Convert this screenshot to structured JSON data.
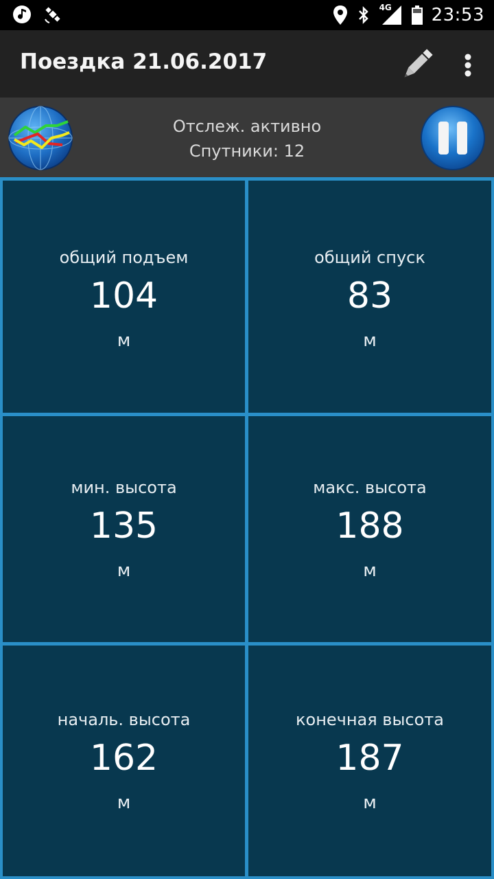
{
  "status_bar": {
    "time": "23:53",
    "network": "4G",
    "icons": [
      "music-note-icon",
      "satellite-icon",
      "location-pin-icon",
      "bluetooth-icon",
      "signal-icon",
      "battery-icon"
    ]
  },
  "app_bar": {
    "title": "Поездка 21.06.2017",
    "actions": [
      "pencil-icon",
      "overflow-menu-icon"
    ]
  },
  "tracking": {
    "status": "Отслеж. активно",
    "satellites": "Спутники: 12",
    "left_icon": "track-globe-icon",
    "right_icon": "pause-icon"
  },
  "stats": [
    {
      "label": "общий подъем",
      "value": "104",
      "unit": "м"
    },
    {
      "label": "общий спуск",
      "value": "83",
      "unit": "м"
    },
    {
      "label": "мин. высота",
      "value": "135",
      "unit": "м"
    },
    {
      "label": "макс. высота",
      "value": "188",
      "unit": "м"
    },
    {
      "label": "началь. высота",
      "value": "162",
      "unit": "м"
    },
    {
      "label": "конечная высота",
      "value": "187",
      "unit": "м"
    }
  ],
  "colors": {
    "cell_background": "#08384f",
    "grid_lines": "#2a8fc8",
    "app_bar": "#222222",
    "tracking_bar": "#393939",
    "button_blue": "#1a73c9"
  }
}
